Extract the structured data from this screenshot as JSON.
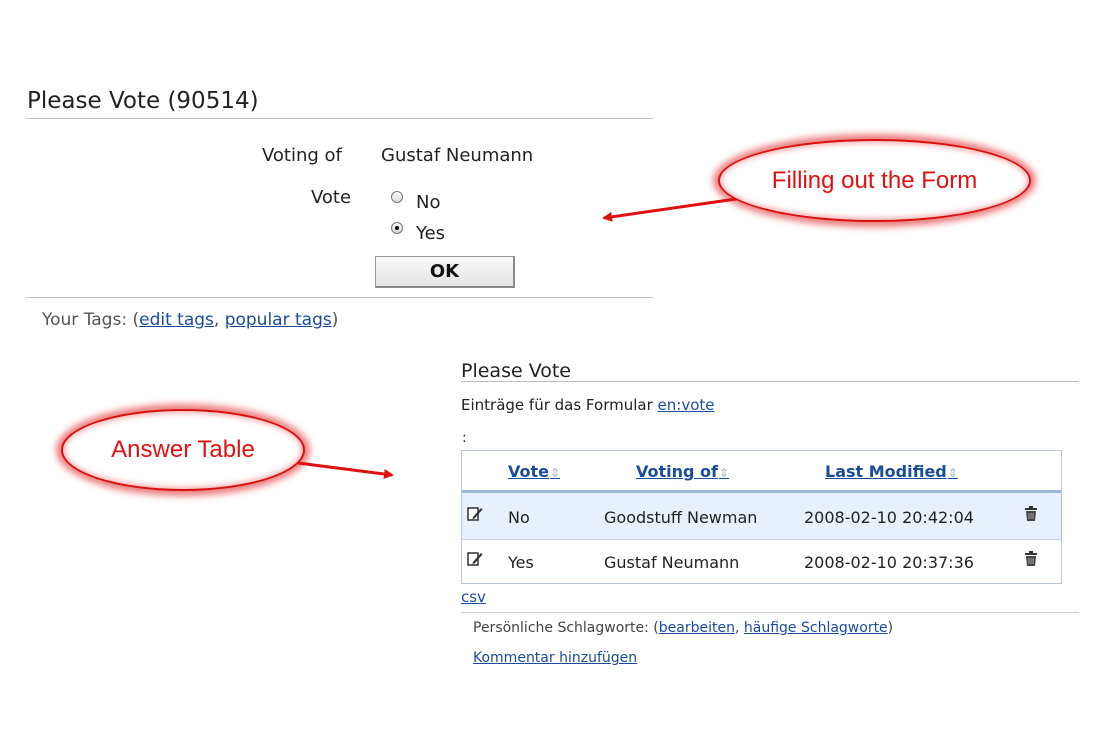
{
  "form": {
    "title": "Please Vote (90514)",
    "voting_of_label": "Voting of",
    "voting_of_value": "Gustaf Neumann",
    "vote_label": "Vote",
    "options": [
      {
        "label": "No",
        "checked": false
      },
      {
        "label": "Yes",
        "checked": true
      }
    ],
    "ok_label": "OK"
  },
  "tags": {
    "prefix": "Your Tags: (",
    "edit": "edit tags",
    "sep": ", ",
    "popular": "popular tags",
    "suffix": ")"
  },
  "callouts": {
    "form": "Filling out the Form",
    "table": "Answer Table"
  },
  "answers": {
    "title": "Please Vote",
    "entries_text": "Einträge für das Formular ",
    "entries_link": "en:vote",
    "colon": ":",
    "columns": [
      "Vote",
      "Voting of",
      "Last Modified"
    ],
    "rows": [
      {
        "vote": "No",
        "voting_of": "Goodstuff Newman",
        "modified": "2008-02-10 20:42:04"
      },
      {
        "vote": "Yes",
        "voting_of": "Gustaf Neumann",
        "modified": "2008-02-10 20:37:36"
      }
    ],
    "csv": "csv",
    "personal_prefix": "Persönliche Schlagworte: (",
    "personal_edit": "bearbeiten",
    "personal_sep": ", ",
    "personal_popular": "häufige Schlagworte",
    "personal_suffix": ")",
    "add_comment": "Kommentar hinzufügen"
  },
  "icons": {
    "edit": "edit-pencil-icon",
    "delete": "trash-icon",
    "sort": "sort-arrows-icon"
  }
}
